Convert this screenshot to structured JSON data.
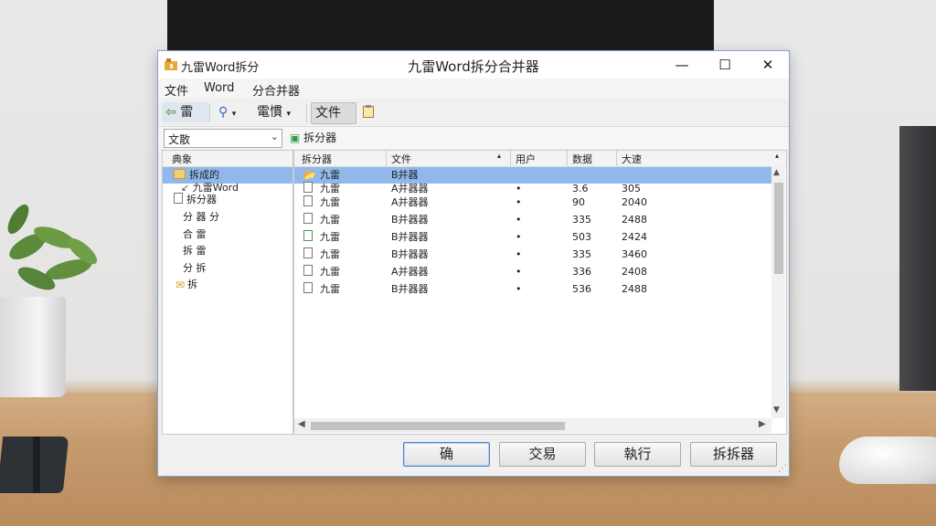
{
  "window": {
    "app_label": "九雷Word拆分",
    "title": "九雷Word拆分合并器",
    "min_glyph": "—",
    "max_glyph": "☐",
    "close_glyph": "✕"
  },
  "menu": [
    "文件",
    "Word",
    "分合并器"
  ],
  "toolbar": {
    "btn1": "雷",
    "btn3": "電慣",
    "btn4": "文件"
  },
  "subbar": {
    "combo_value": "文散",
    "action": "拆分器"
  },
  "tree": {
    "header": "典象",
    "items": [
      {
        "label": "拆成的",
        "icon": "folder-icon",
        "indent": 0,
        "selected": true
      },
      {
        "label": "九雷Word",
        "icon": "arrow-icon",
        "indent": 1,
        "selected": false
      },
      {
        "label": "拆分器",
        "icon": "doc-icon",
        "indent": 0,
        "selected": false
      },
      {
        "label": "分 器 分",
        "icon": "",
        "indent": 1,
        "selected": false
      },
      {
        "label": "合 雷",
        "icon": "",
        "indent": 1,
        "selected": false
      },
      {
        "label": "拆 雷",
        "icon": "",
        "indent": 1,
        "selected": false
      },
      {
        "label": "分 拆",
        "icon": "",
        "indent": 1,
        "selected": false
      },
      {
        "label": "拆",
        "icon": "star-icon",
        "indent": 0,
        "selected": false
      }
    ]
  },
  "list": {
    "columns": [
      "拆分器",
      "文件",
      "用户",
      "数据",
      "大速"
    ],
    "rows": [
      {
        "name": "九雷",
        "type": "B并器",
        "user": "",
        "num": "",
        "size": "",
        "selected": true
      },
      {
        "name": "九雷",
        "type": "A并器器",
        "user": "•",
        "num": "3.6",
        "size": "305",
        "selected": false
      },
      {
        "name": "九雷",
        "type": "A并器器",
        "user": "•",
        "num": "90",
        "size": "2040",
        "selected": false
      },
      {
        "name": "九雷",
        "type": "B并器器",
        "user": "•",
        "num": "335",
        "size": "2488",
        "selected": false
      },
      {
        "name": "九雷",
        "type": "B并器器",
        "user": "•",
        "num": "503",
        "size": "2424",
        "selected": false
      },
      {
        "name": "九雷",
        "type": "B并器器",
        "user": "•",
        "num": "335",
        "size": "3460",
        "selected": false
      },
      {
        "name": "九雷",
        "type": "A并器器",
        "user": "•",
        "num": "336",
        "size": "2408",
        "selected": false
      },
      {
        "name": "九雷",
        "type": "B并器器",
        "user": "•",
        "num": "536",
        "size": "2488",
        "selected": false
      }
    ]
  },
  "buttons": [
    "确",
    "交易",
    "執行",
    "拆拆器"
  ]
}
